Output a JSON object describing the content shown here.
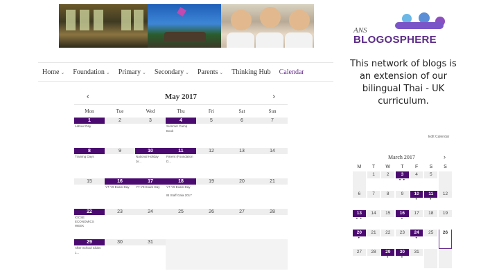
{
  "nav": {
    "items": [
      {
        "label": "Home",
        "chevron": true
      },
      {
        "label": "Foundation",
        "chevron": true
      },
      {
        "label": "Primary",
        "chevron": true
      },
      {
        "label": "Secondary",
        "chevron": true
      },
      {
        "label": "Parents",
        "chevron": true
      },
      {
        "label": "Thinking Hub",
        "chevron": false
      },
      {
        "label": "Calendar",
        "chevron": false,
        "active": true
      }
    ]
  },
  "calendar": {
    "title": "May 2017",
    "prev": "‹",
    "next": "›",
    "days": [
      "Mon",
      "Tue",
      "Wed",
      "Thu",
      "Fri",
      "Sat",
      "Sun"
    ],
    "weeks": [
      [
        {
          "n": "1",
          "hl": true,
          "ev": [
            "Labour Day"
          ]
        },
        {
          "n": "2"
        },
        {
          "n": "3"
        },
        {
          "n": "4",
          "hl": true,
          "ev": [
            "Summer Camp",
            "Book"
          ]
        },
        {
          "n": "5"
        },
        {
          "n": "6"
        },
        {
          "n": "7"
        }
      ],
      [
        {
          "n": "8",
          "hl": true,
          "ev": [
            "Training Days"
          ]
        },
        {
          "n": "9"
        },
        {
          "n": "10",
          "hl": true,
          "ev": [
            "National Holiday",
            "(V..."
          ]
        },
        {
          "n": "11",
          "hl": true,
          "ev": [
            "Parent (Foundation",
            "D..."
          ]
        },
        {
          "n": "12"
        },
        {
          "n": "13"
        },
        {
          "n": "14"
        }
      ],
      [
        {
          "n": "15"
        },
        {
          "n": "16",
          "hl": true,
          "ev": [
            "Y7-Y9 Exam Day"
          ]
        },
        {
          "n": "17",
          "hl": true,
          "ev": [
            "Y7-Y9 Exam Day"
          ]
        },
        {
          "n": "18",
          "hl": true,
          "ev": [
            "Y7-Y9 Exam Day",
            "",
            "IB Staff Gala 2017"
          ]
        },
        {
          "n": "19"
        },
        {
          "n": "20"
        },
        {
          "n": "21"
        }
      ],
      [
        {
          "n": "22",
          "hl": true,
          "ev": [
            "IGCSE ECONOMICS",
            "WEEK"
          ]
        },
        {
          "n": "23"
        },
        {
          "n": "24"
        },
        {
          "n": "25"
        },
        {
          "n": "26"
        },
        {
          "n": "27"
        },
        {
          "n": "28"
        }
      ],
      [
        {
          "n": "29",
          "hl": true,
          "ev": [
            "After School Clubs",
            "1..."
          ]
        },
        {
          "n": "30"
        },
        {
          "n": "31"
        },
        {
          "blank": true
        },
        {
          "blank": true
        },
        {
          "blank": true
        },
        {
          "blank": true
        }
      ]
    ]
  },
  "widget": {
    "logo_small": "ANS",
    "logo_big": "BLOGOSPHERE",
    "tagline": "This network of blogs is an extension of our bilingual Thai - UK curriculum.",
    "edit_link": "Edit Calendar"
  },
  "mini_calendar": {
    "title": "March 2017",
    "next": "›",
    "days": [
      "M",
      "T",
      "W",
      "T",
      "F",
      "S",
      "S"
    ],
    "weeks": [
      [
        {
          "blank": true
        },
        {
          "n": "1"
        },
        {
          "n": "2"
        },
        {
          "n": "3",
          "hl": true,
          "dots": "• •"
        },
        {
          "n": "4"
        },
        {
          "n": "5"
        },
        {
          "blank": true
        }
      ],
      [
        {
          "n": "6"
        },
        {
          "n": "7"
        },
        {
          "n": "8"
        },
        {
          "n": "9"
        },
        {
          "n": "10",
          "hl": true,
          "dots": "•"
        },
        {
          "n": "11",
          "hl": true,
          "dots": "•"
        },
        {
          "n": "12"
        }
      ],
      [
        {
          "n": "13",
          "hl": true,
          "dots": "• •"
        },
        {
          "n": "14"
        },
        {
          "n": "15"
        },
        {
          "n": "16",
          "hl": true,
          "dots": "•"
        },
        {
          "n": "17"
        },
        {
          "n": "18"
        },
        {
          "n": "19"
        }
      ],
      [
        {
          "n": "20",
          "hl": true,
          "dots": "•"
        },
        {
          "n": "21"
        },
        {
          "n": "22"
        },
        {
          "n": "23"
        },
        {
          "n": "24",
          "hl": true,
          "dots": "•"
        },
        {
          "n": "25"
        },
        {
          "n": "26",
          "today": true
        }
      ],
      [
        {
          "n": "27"
        },
        {
          "n": "28"
        },
        {
          "n": "29",
          "hl": true,
          "dots": "•"
        },
        {
          "n": "30",
          "hl": true,
          "dots": "•"
        },
        {
          "n": "31"
        },
        {
          "blank": true
        },
        {
          "blank": true
        }
      ]
    ]
  }
}
